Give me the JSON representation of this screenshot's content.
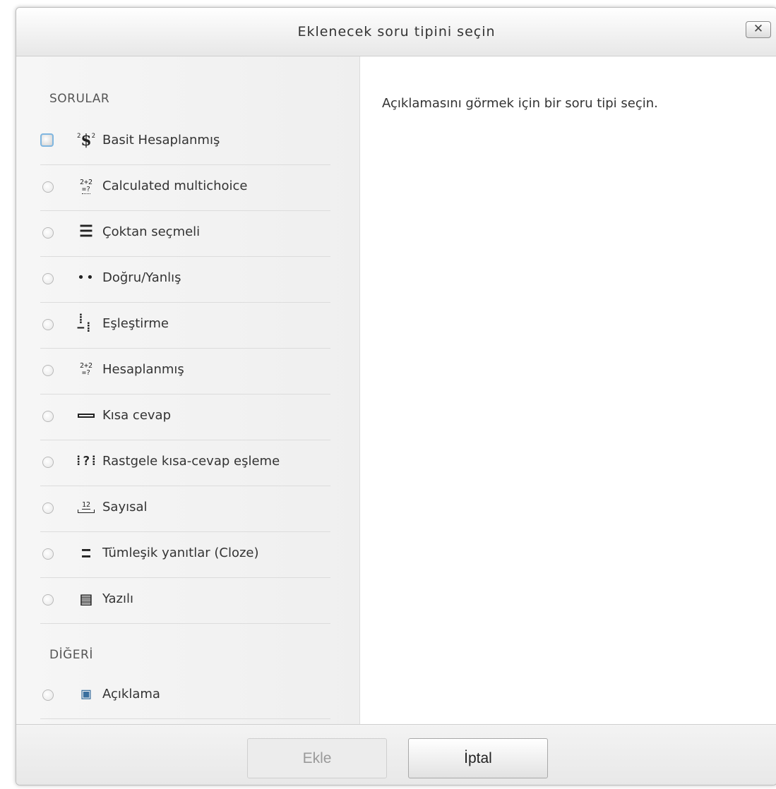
{
  "dialog": {
    "title": "Eklenecek soru tipini seçin",
    "close_label": "✕",
    "description_placeholder": "Açıklamasını görmek için bir soru tipi seçin."
  },
  "sections": {
    "questions_label": "SORULAR",
    "other_label": "DİĞERİ"
  },
  "question_types": [
    {
      "label": "Basit Hesaplanmış",
      "icon": "simple-calculated-icon",
      "focused": true
    },
    {
      "label": "Calculated multichoice",
      "icon": "calculated-multichoice-icon",
      "focused": false
    },
    {
      "label": "Çoktan seçmeli",
      "icon": "multichoice-icon",
      "focused": false
    },
    {
      "label": "Doğru/Yanlış",
      "icon": "truefalse-icon",
      "focused": false
    },
    {
      "label": "Eşleştirme",
      "icon": "match-icon",
      "focused": false
    },
    {
      "label": "Hesaplanmış",
      "icon": "calculated-icon",
      "focused": false
    },
    {
      "label": "Kısa cevap",
      "icon": "shortanswer-icon",
      "focused": false
    },
    {
      "label": "Rastgele kısa-cevap eşleme",
      "icon": "random-shortanswer-match-icon",
      "focused": false
    },
    {
      "label": "Sayısal",
      "icon": "numerical-icon",
      "focused": false
    },
    {
      "label": "Tümleşik yanıtlar (Cloze)",
      "icon": "cloze-icon",
      "focused": false
    },
    {
      "label": "Yazılı",
      "icon": "essay-icon",
      "focused": false
    }
  ],
  "other_types": [
    {
      "label": "Açıklama",
      "icon": "description-icon",
      "focused": false
    }
  ],
  "footer": {
    "add_label": "Ekle",
    "cancel_label": "İptal"
  },
  "icon_glyphs": {
    "simple_calculated": "$",
    "calc_multi_top": "2+2",
    "calc_multi_bottom": "=?",
    "calculated_top": "2+2",
    "calculated_bottom": "=?",
    "multichoice": "☰",
    "truefalse": "••",
    "match": "⁞−⁞",
    "random_match": "⁞?⁞",
    "numerical": "12",
    "cloze": "▬▬",
    "essay": "▤",
    "description": "▣"
  }
}
